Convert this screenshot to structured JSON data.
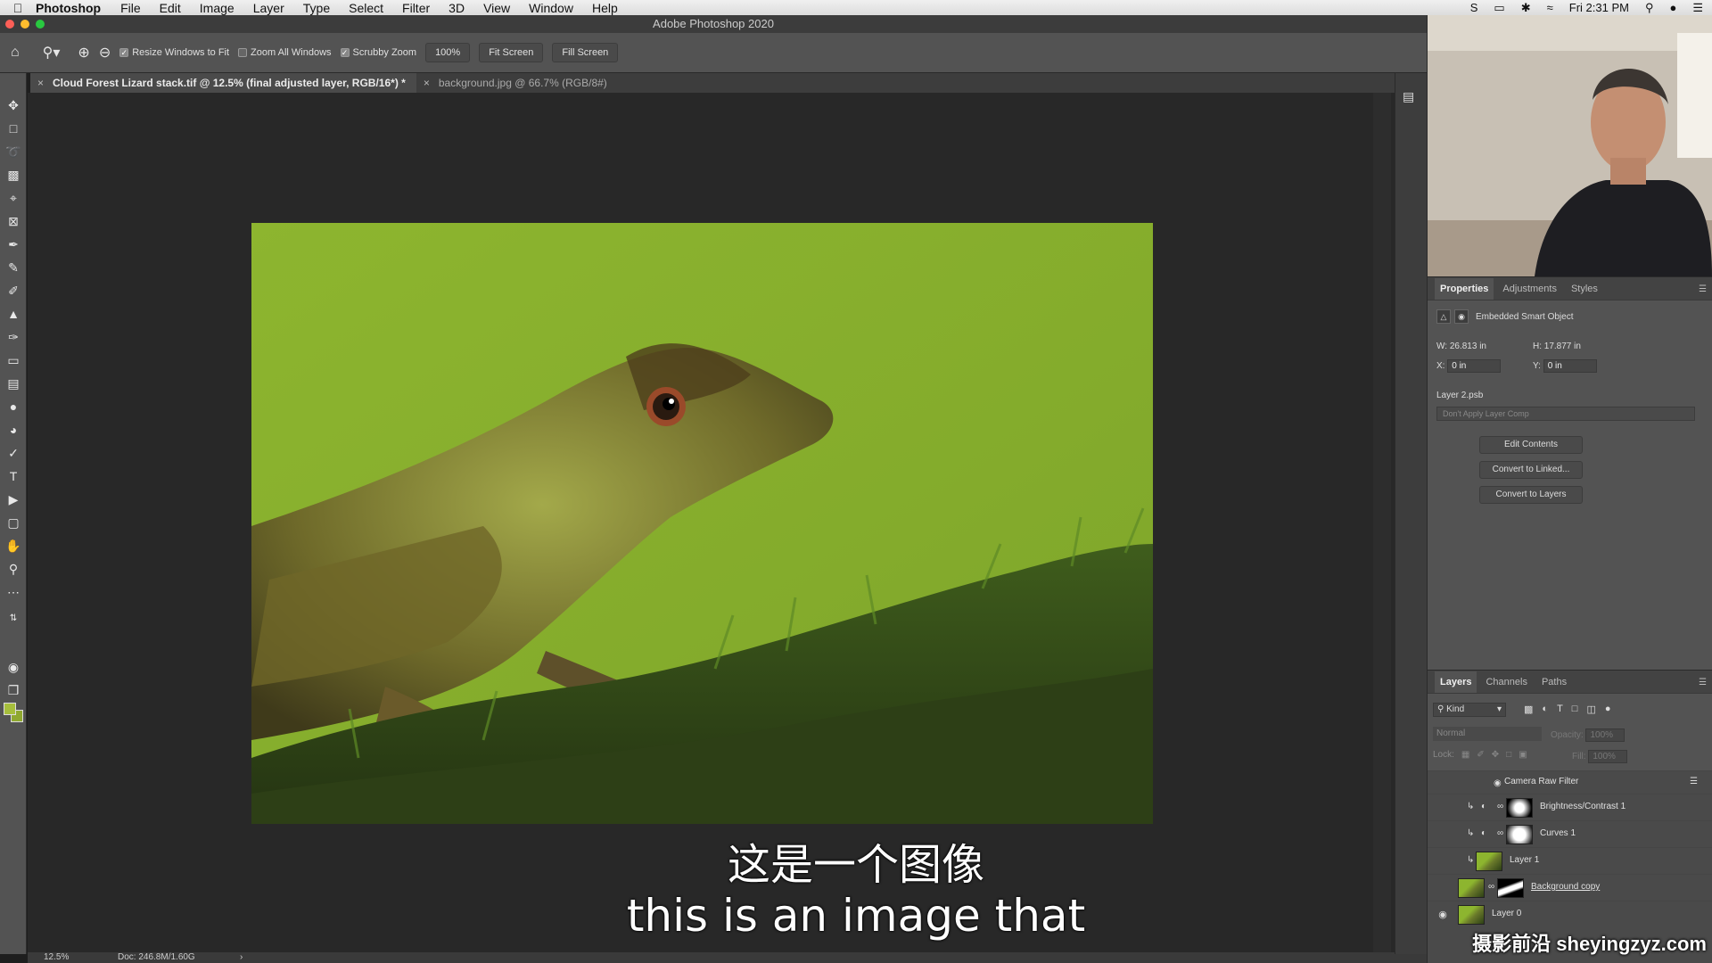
{
  "menubar": {
    "app": "Photoshop",
    "items": [
      "File",
      "Edit",
      "Image",
      "Layer",
      "Type",
      "Select",
      "Filter",
      "3D",
      "View",
      "Window",
      "Help"
    ],
    "clock": "Fri 2:31 PM"
  },
  "window": {
    "title": "Adobe Photoshop 2020"
  },
  "options": {
    "resize_windows": "Resize Windows to Fit",
    "zoom_all": "Zoom All Windows",
    "scrubby": "Scrubby Zoom",
    "zoom_value": "100%",
    "fit_screen": "Fit Screen",
    "fill_screen": "Fill Screen"
  },
  "tabs": [
    {
      "label": "Cloud Forest Lizard stack.tif @ 12.5% (final adjusted layer, RGB/16*) *",
      "active": true
    },
    {
      "label": "background.jpg @ 66.7% (RGB/8#)",
      "active": false
    }
  ],
  "status": {
    "zoom": "12.5%",
    "doc": "Doc: 246.8M/1.60G"
  },
  "subtitles": {
    "chinese": "这是一个图像",
    "english": "this is an image that"
  },
  "watermark": "摄影前沿 sheyingzyz.com",
  "properties": {
    "tabs": [
      "Properties",
      "Adjustments",
      "Styles"
    ],
    "type": "Embedded Smart Object",
    "w_label": "W:",
    "w": "26.813 in",
    "h_label": "H:",
    "h": "17.877 in",
    "x_label": "X:",
    "x": "0 in",
    "y_label": "Y:",
    "y": "0 in",
    "file": "Layer 2.psb",
    "comp": "Don't Apply Layer Comp",
    "buttons": [
      "Edit Contents",
      "Convert to Linked...",
      "Convert to Layers"
    ]
  },
  "layers_panel": {
    "tabs": [
      "Layers",
      "Channels",
      "Paths"
    ],
    "filter": "Kind",
    "blend": "Normal",
    "opacity_label": "Opacity:",
    "opacity": "100%",
    "lock_label": "Lock:",
    "fill_label": "Fill:",
    "fill": "100%",
    "layers": [
      {
        "name": "Camera Raw Filter",
        "kind": "filter"
      },
      {
        "name": "Brightness/Contrast 1",
        "kind": "adjustment"
      },
      {
        "name": "Curves 1",
        "kind": "adjustment"
      },
      {
        "name": "Layer 1",
        "kind": "pixel"
      },
      {
        "name": "Background copy",
        "kind": "masked"
      },
      {
        "name": "Layer 0",
        "kind": "pixel"
      }
    ]
  },
  "colors": {
    "accent_green": "#88ad2d",
    "panel": "#535353",
    "canvas_bg": "#282828"
  }
}
